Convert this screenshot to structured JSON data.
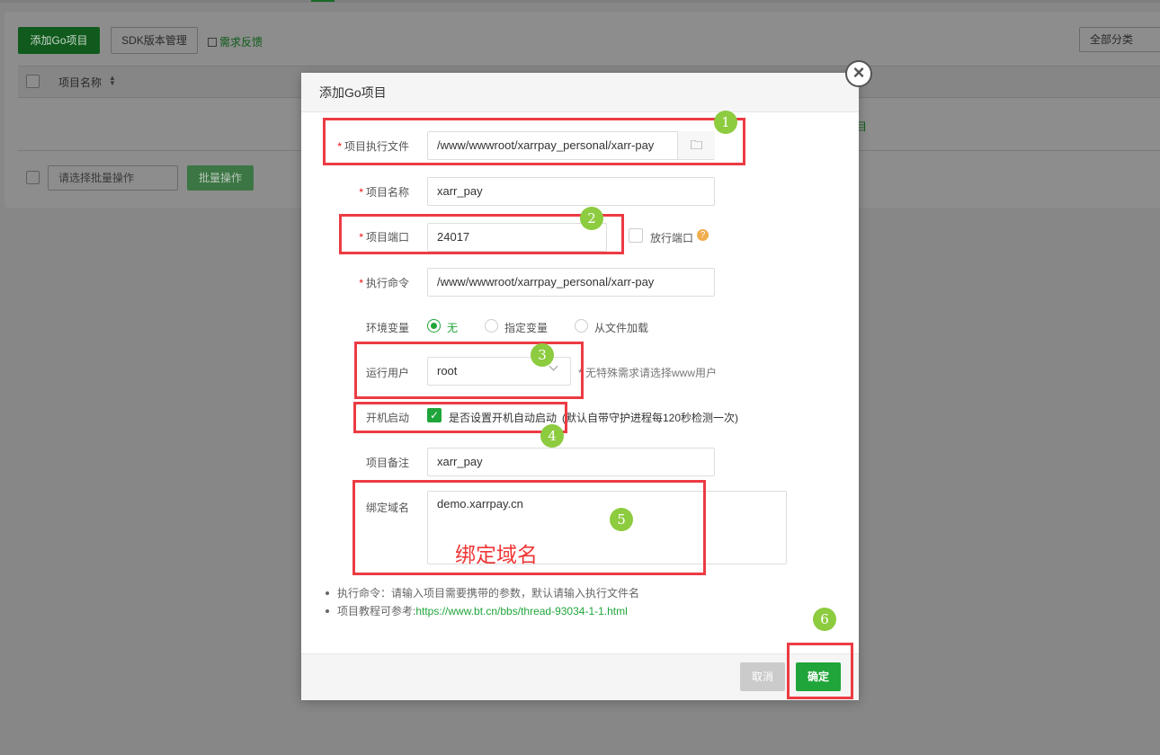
{
  "background": {
    "add_project_button": "添加Go项目",
    "sdk_button": "SDK版本管理",
    "feedback_link": "需求反馈",
    "category_select": "全部分类",
    "table_header_name": "项目名称",
    "batch_select_placeholder": "请选择批量操作",
    "batch_button": "批量操作",
    "green_fragment": "目"
  },
  "modal": {
    "title": "添加Go项目",
    "fields": {
      "exec_file": {
        "label": "项目执行文件",
        "value": "/www/wwwroot/xarrpay_personal/xarr-pay"
      },
      "project_name": {
        "label": "项目名称",
        "value": "xarr_pay"
      },
      "port": {
        "label": "项目端口",
        "value": "24017",
        "allow_port_label": "放行端口",
        "help": "?"
      },
      "exec_cmd": {
        "label": "执行命令",
        "value": "/www/wwwroot/xarrpay_personal/xarr-pay"
      },
      "env": {
        "label": "环境变量",
        "options": [
          "无",
          "指定变量",
          "从文件加载"
        ],
        "selected": "无"
      },
      "run_user": {
        "label": "运行用户",
        "value": "root",
        "hint": "* 无特殊需求请选择www用户"
      },
      "autostart": {
        "label": "开机启动",
        "checkbox_label": "是否设置开机自动启动",
        "note": "(默认自带守护进程每120秒检测一次)"
      },
      "remark": {
        "label": "项目备注",
        "value": "xarr_pay"
      },
      "domain": {
        "label": "绑定域名",
        "value": "demo.xarrpay.cn"
      }
    },
    "tips": {
      "tip1": "执行命令：请输入项目需要携带的参数，默认请输入执行文件名",
      "tip2_prefix": "项目教程可参考:",
      "tip2_link": "https://www.bt.cn/bbs/thread-93034-1-1.html"
    },
    "cancel": "取消",
    "confirm": "确定"
  },
  "annotations": {
    "numbers": [
      "1",
      "2",
      "3",
      "4",
      "5",
      "6"
    ],
    "domain_text": "绑定域名"
  },
  "colors": {
    "accent": "#20a53a",
    "annotation_red": "#ec3b43",
    "annotation_badge": "#8dcb3f"
  }
}
